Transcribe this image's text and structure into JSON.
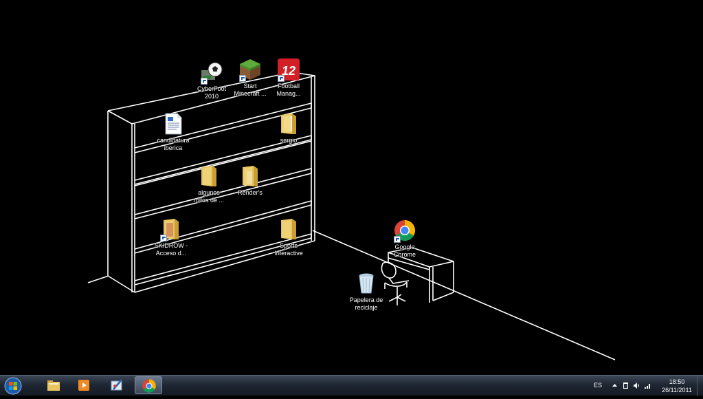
{
  "desktop": {
    "icons": [
      {
        "id": "cyberfoot",
        "label": "CyberFoot\n2010"
      },
      {
        "id": "minecraft",
        "label": "Start\nMinecraft ..."
      },
      {
        "id": "football-manager",
        "label": "Football\nManag...",
        "badge_text": "12"
      },
      {
        "id": "candidatura",
        "label": "candidatura\niberica"
      },
      {
        "id": "sergio",
        "label": "sergio"
      },
      {
        "id": "algunos",
        "label": "algunos\nrollos de ..."
      },
      {
        "id": "renders",
        "label": "Render's"
      },
      {
        "id": "skidrow",
        "label": "SKIDROW -\nAcceso d..."
      },
      {
        "id": "sports-interactive",
        "label": "Sports\nInteractive"
      },
      {
        "id": "google-chrome",
        "label": "Google\nChrome"
      },
      {
        "id": "recycle-bin",
        "label": "Papelera de\nreciclaje"
      }
    ]
  },
  "taskbar": {
    "pinned": [
      "explorer-icon",
      "media-player-icon",
      "paint-icon",
      "chrome-icon"
    ],
    "active": "chrome-icon",
    "tray": {
      "language": "ES",
      "time": "18:50",
      "date": "26/11/2011"
    }
  },
  "colors": {
    "background": "#000000",
    "line": "#ffffff",
    "taskbar": "#1f2733"
  }
}
